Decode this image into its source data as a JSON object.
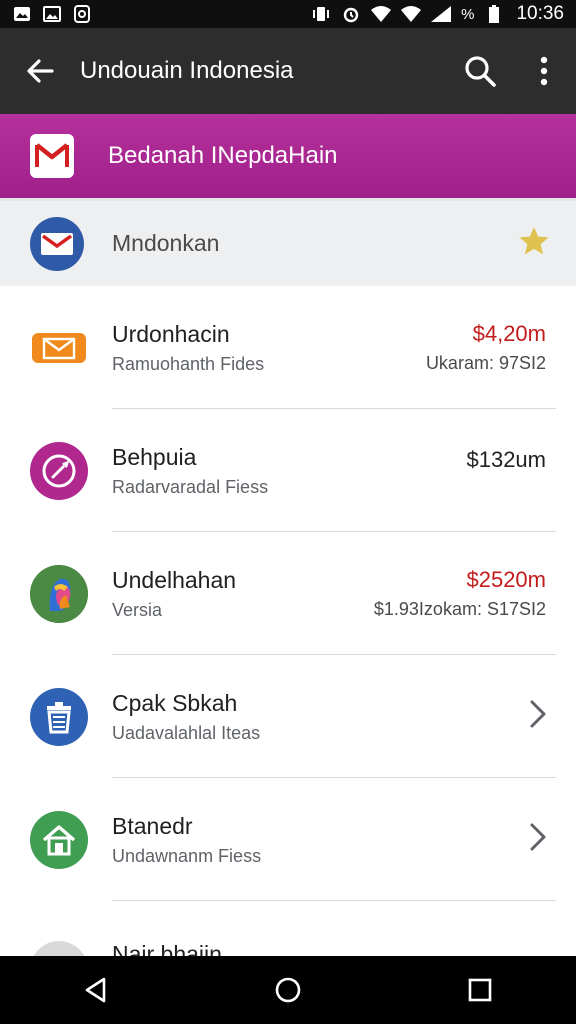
{
  "status_bar": {
    "battery_pct": "%",
    "time": "10:36"
  },
  "app_bar": {
    "title": "Undouain Indonesia"
  },
  "banner": {
    "title": "Bedanah INepdaHain"
  },
  "pinned": {
    "label": "Mndonkan"
  },
  "rows": [
    {
      "name": "Urdonhacin",
      "sub": "Ramuohanth Fides",
      "amount": "$4,20m",
      "meta": "Ukaram: 97SI2"
    },
    {
      "name": "Behpuia",
      "sub": "Radarvaradal Fiess",
      "amount": "$132um",
      "meta": ""
    },
    {
      "name": "Undelhahan",
      "sub": "Versia",
      "amount": "$2520m",
      "meta": "$1.93Izokam: S17SI2"
    },
    {
      "name": "Cpak Sbkah",
      "sub": "Uadavalahlal Iteas"
    },
    {
      "name": "Btanedr",
      "sub": "Undawnanm Fiess"
    },
    {
      "name": "Nair bhaiin",
      "sub": ""
    }
  ],
  "colors": {
    "app_bar": "#2d2d2d",
    "banner": "#a72590",
    "amount_red": "#c41c1c"
  }
}
